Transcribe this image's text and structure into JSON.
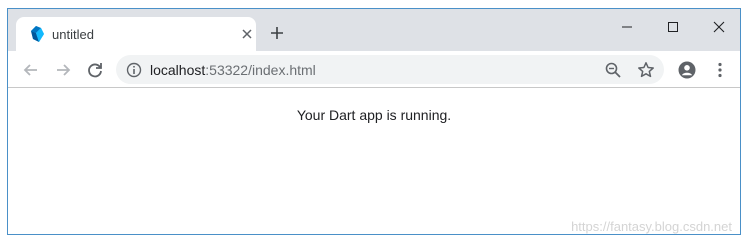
{
  "tab": {
    "title": "untitled",
    "favicon": "dart-logo-icon"
  },
  "window_controls": {
    "minimize": "minimize-icon",
    "maximize": "maximize-icon",
    "close": "close-icon"
  },
  "address_bar": {
    "url_host": "localhost",
    "url_rest": ":53322/index.html"
  },
  "page": {
    "message": "Your Dart app is running."
  },
  "watermark": "https://fantasy.blog.csdn.net",
  "colors": {
    "dart_teal": "#0175c2",
    "dart_cyan": "#13b9fd",
    "tabstrip": "#dee1e6",
    "window_border": "#4a90c8"
  }
}
